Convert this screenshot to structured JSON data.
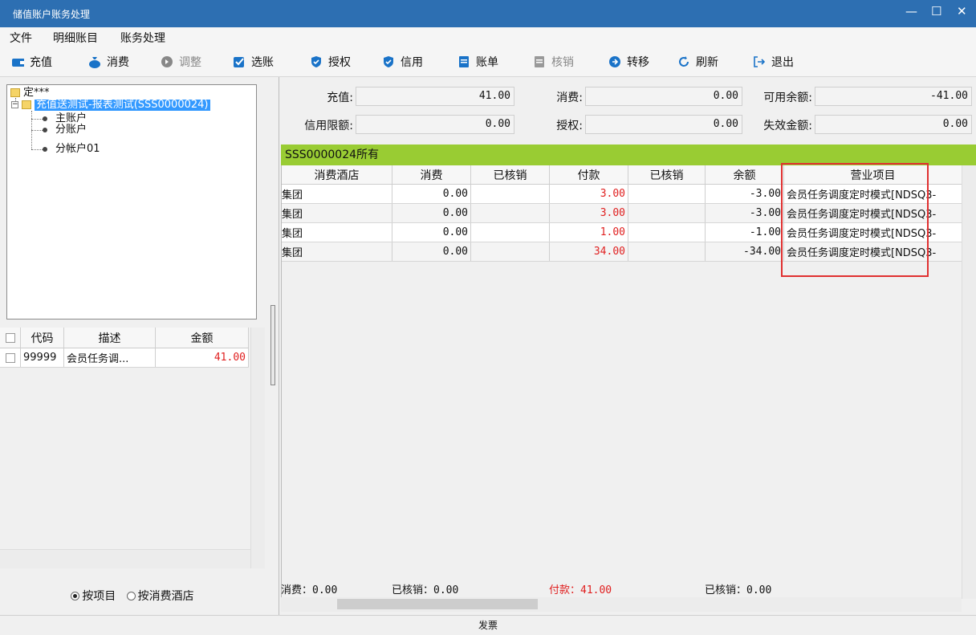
{
  "window": {
    "title": "储值账户账务处理"
  },
  "menu": [
    "文件",
    "明细账目",
    "账务处理"
  ],
  "toolbar": [
    {
      "label": "充值",
      "icon": "wallet-icon",
      "enabled": true
    },
    {
      "label": "消费",
      "icon": "moneybag-icon",
      "enabled": true
    },
    {
      "label": "调整",
      "icon": "adjust-icon",
      "enabled": false
    },
    {
      "label": "选账",
      "icon": "checkbox-icon",
      "enabled": true
    },
    {
      "label": "授权",
      "icon": "shield-icon",
      "enabled": true
    },
    {
      "label": "信用",
      "icon": "shield-icon",
      "enabled": true
    },
    {
      "label": "账单",
      "icon": "document-icon",
      "enabled": true
    },
    {
      "label": "核销",
      "icon": "document-icon",
      "enabled": false
    },
    {
      "label": "转移",
      "icon": "arrow-circle-icon",
      "enabled": true
    },
    {
      "label": "刷新",
      "icon": "refresh-icon",
      "enabled": true
    },
    {
      "label": "退出",
      "icon": "exit-icon",
      "enabled": true
    }
  ],
  "tree": {
    "root": "定***",
    "account": "充值送测试-报表测试(SSS0000024)",
    "children": [
      "主账户",
      "分账户",
      "分帐户01"
    ]
  },
  "left_grid": {
    "columns": [
      "代码",
      "描述",
      "金额"
    ],
    "rows": [
      {
        "code": "99999",
        "desc": "会员任务调...",
        "amount": "41.00"
      }
    ]
  },
  "radios": {
    "by_item": "按项目",
    "by_hotel": "按消费酒店",
    "selected": "by_item"
  },
  "summary": {
    "recharge_label": "充值:",
    "recharge": "41.00",
    "consume_label": "消费:",
    "consume": "0.00",
    "available_label": "可用余额:",
    "available": "-41.00",
    "credit_label": "信用限额:",
    "credit": "0.00",
    "auth_label": "授权:",
    "auth": "0.00",
    "expired_label": "失效金额:",
    "expired": "0.00"
  },
  "grid_title": "SSS0000024所有",
  "grid": {
    "columns": [
      "消费酒店",
      "消费",
      "已核销",
      "付款",
      "已核销",
      "余额",
      "营业项目"
    ],
    "rows": [
      {
        "hotel": "集团",
        "consume": "0.00",
        "v1": "",
        "pay": "3.00",
        "v2": "",
        "balance": "-3.00",
        "item": "会员任务调度定时模式[NDSQ3-"
      },
      {
        "hotel": "集团",
        "consume": "0.00",
        "v1": "",
        "pay": "3.00",
        "v2": "",
        "balance": "-3.00",
        "item": "会员任务调度定时模式[NDSQ3-"
      },
      {
        "hotel": "集团",
        "consume": "0.00",
        "v1": "",
        "pay": "1.00",
        "v2": "",
        "balance": "-1.00",
        "item": "会员任务调度定时模式[NDSQ3-"
      },
      {
        "hotel": "集团",
        "consume": "0.00",
        "v1": "",
        "pay": "34.00",
        "v2": "",
        "balance": "-34.00",
        "item": "会员任务调度定时模式[NDSQ3-"
      }
    ]
  },
  "totals": {
    "consume": "消费：0.00",
    "v1": "已核销：0.00",
    "pay": "付款：41.00",
    "v2": "已核销：0.00"
  },
  "status": "发票",
  "colors": {
    "titlebar": "#2d6fb2",
    "green": "#99cc33",
    "red": "#e02020",
    "highlight": "#e03030",
    "select": "#3399ff"
  }
}
